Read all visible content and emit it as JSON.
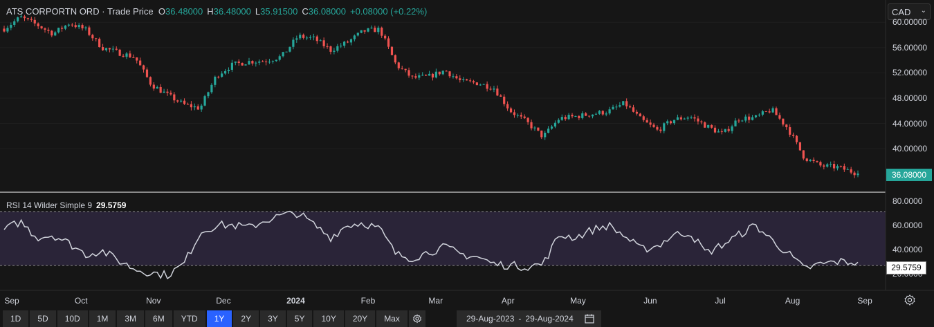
{
  "legend": {
    "symbol": "ATS CORPORTN ORD",
    "separator": "·",
    "series_type": "Trade Price",
    "open_key": "O",
    "open": "36.48000",
    "high_key": "H",
    "high": "36.48000",
    "low_key": "L",
    "low": "35.91500",
    "close_key": "C",
    "close": "36.08000",
    "change": "+0.08000 (+0.22%)"
  },
  "currency": {
    "selected": "CAD",
    "icon": "chevron-down-icon"
  },
  "price_axis": {
    "ticks": [
      "60.00000",
      "56.00000",
      "52.00000",
      "48.00000",
      "44.00000",
      "40.00000"
    ],
    "last_price": "36.08000"
  },
  "rsi": {
    "label": "RSI 14 Wilder Simple 9",
    "value": "29.5759",
    "axis_ticks": [
      "80.0000",
      "60.0000",
      "40.0000",
      "20.0000"
    ],
    "bands": [
      70,
      30
    ]
  },
  "time_axis": [
    "Sep",
    "Oct",
    "Nov",
    "Dec",
    "2024",
    "Feb",
    "Mar",
    "Apr",
    "May",
    "Jun",
    "Jul",
    "Aug",
    "Sep"
  ],
  "toolbar": {
    "ranges": [
      "1D",
      "5D",
      "10D",
      "1M",
      "3M",
      "6M",
      "YTD",
      "1Y",
      "2Y",
      "3Y",
      "5Y",
      "10Y",
      "20Y",
      "Max"
    ],
    "active": "1Y",
    "date_from": "29-Aug-2023",
    "date_sep": "-",
    "date_to": "29-Aug-2024",
    "calendar_icon": "calendar-icon",
    "settings_icon": "gear-icon"
  },
  "colors": {
    "up": "#26a69a",
    "down": "#ef5350",
    "rsi_line": "#d1d4dc",
    "band": "#2a2438",
    "active": "#2962ff"
  },
  "chart_data": [
    {
      "type": "candlestick",
      "title": "ATS CORPORTN ORD",
      "ylim": [
        34,
        62
      ],
      "x_range": [
        "2023-08-29",
        "2024-08-29"
      ],
      "close_path": [
        [
          "2023-08-29",
          59.0
        ],
        [
          "2023-09-05",
          60.8
        ],
        [
          "2023-09-12",
          59.6
        ],
        [
          "2023-09-19",
          58.2
        ],
        [
          "2023-09-26",
          59.9
        ],
        [
          "2023-10-03",
          58.8
        ],
        [
          "2023-10-10",
          56.0
        ],
        [
          "2023-10-17",
          55.2
        ],
        [
          "2023-10-24",
          54.5
        ],
        [
          "2023-10-31",
          50.2
        ],
        [
          "2023-11-07",
          48.5
        ],
        [
          "2023-11-14",
          47.0
        ],
        [
          "2023-11-21",
          46.4
        ],
        [
          "2023-11-28",
          51.6
        ],
        [
          "2023-12-05",
          53.3
        ],
        [
          "2023-12-12",
          53.8
        ],
        [
          "2023-12-19",
          53.9
        ],
        [
          "2023-12-26",
          54.6
        ],
        [
          "2024-01-02",
          57.8
        ],
        [
          "2024-01-09",
          57.4
        ],
        [
          "2024-01-16",
          55.6
        ],
        [
          "2024-01-23",
          56.8
        ],
        [
          "2024-01-30",
          58.6
        ],
        [
          "2024-02-06",
          58.9
        ],
        [
          "2024-02-13",
          53.3
        ],
        [
          "2024-02-20",
          51.2
        ],
        [
          "2024-02-27",
          51.4
        ],
        [
          "2024-03-05",
          52.4
        ],
        [
          "2024-03-12",
          50.6
        ],
        [
          "2024-03-19",
          50.4
        ],
        [
          "2024-03-26",
          49.6
        ],
        [
          "2024-04-02",
          46.0
        ],
        [
          "2024-04-09",
          44.2
        ],
        [
          "2024-04-16",
          41.9
        ],
        [
          "2024-04-23",
          44.8
        ],
        [
          "2024-04-30",
          45.1
        ],
        [
          "2024-05-07",
          45.5
        ],
        [
          "2024-05-14",
          45.9
        ],
        [
          "2024-05-21",
          47.2
        ],
        [
          "2024-05-28",
          44.6
        ],
        [
          "2024-06-04",
          42.9
        ],
        [
          "2024-06-11",
          44.6
        ],
        [
          "2024-06-18",
          45.1
        ],
        [
          "2024-06-25",
          43.6
        ],
        [
          "2024-07-02",
          42.3
        ],
        [
          "2024-07-09",
          44.8
        ],
        [
          "2024-07-16",
          44.9
        ],
        [
          "2024-07-23",
          46.2
        ],
        [
          "2024-07-30",
          43.2
        ],
        [
          "2024-08-06",
          38.6
        ],
        [
          "2024-08-13",
          37.3
        ],
        [
          "2024-08-20",
          37.1
        ],
        [
          "2024-08-29",
          36.08
        ]
      ]
    },
    {
      "type": "line",
      "title": "RSI 14 Wilder Simple 9",
      "ylim": [
        15,
        82
      ],
      "x_range": [
        "2023-08-29",
        "2024-08-29"
      ],
      "points": [
        [
          "2023-08-29",
          56
        ],
        [
          "2023-09-05",
          63
        ],
        [
          "2023-09-12",
          50
        ],
        [
          "2023-09-19",
          52
        ],
        [
          "2023-09-26",
          45
        ],
        [
          "2023-10-03",
          36
        ],
        [
          "2023-10-10",
          39
        ],
        [
          "2023-10-17",
          31
        ],
        [
          "2023-10-24",
          24
        ],
        [
          "2023-10-31",
          21
        ],
        [
          "2023-11-07",
          19
        ],
        [
          "2023-11-14",
          28
        ],
        [
          "2023-11-21",
          54
        ],
        [
          "2023-11-28",
          60
        ],
        [
          "2023-12-05",
          60
        ],
        [
          "2023-12-12",
          58
        ],
        [
          "2023-12-19",
          64
        ],
        [
          "2023-12-26",
          68
        ],
        [
          "2024-01-02",
          70
        ],
        [
          "2024-01-09",
          60
        ],
        [
          "2024-01-16",
          50
        ],
        [
          "2024-01-23",
          60
        ],
        [
          "2024-01-30",
          62
        ],
        [
          "2024-02-06",
          57
        ],
        [
          "2024-02-13",
          36
        ],
        [
          "2024-02-20",
          33
        ],
        [
          "2024-02-27",
          38
        ],
        [
          "2024-03-05",
          42
        ],
        [
          "2024-03-12",
          36
        ],
        [
          "2024-03-19",
          34
        ],
        [
          "2024-03-26",
          28
        ],
        [
          "2024-04-02",
          27
        ],
        [
          "2024-04-09",
          26
        ],
        [
          "2024-04-16",
          28
        ],
        [
          "2024-04-23",
          52
        ],
        [
          "2024-04-30",
          50
        ],
        [
          "2024-05-07",
          56
        ],
        [
          "2024-05-14",
          60
        ],
        [
          "2024-05-21",
          51
        ],
        [
          "2024-05-28",
          40
        ],
        [
          "2024-06-04",
          43
        ],
        [
          "2024-06-11",
          52
        ],
        [
          "2024-06-18",
          54
        ],
        [
          "2024-06-25",
          37
        ],
        [
          "2024-07-02",
          44
        ],
        [
          "2024-07-09",
          52
        ],
        [
          "2024-07-16",
          60
        ],
        [
          "2024-07-23",
          48
        ],
        [
          "2024-07-30",
          37
        ],
        [
          "2024-08-06",
          24
        ],
        [
          "2024-08-13",
          28
        ],
        [
          "2024-08-20",
          30
        ],
        [
          "2024-08-29",
          29.58
        ]
      ]
    }
  ]
}
